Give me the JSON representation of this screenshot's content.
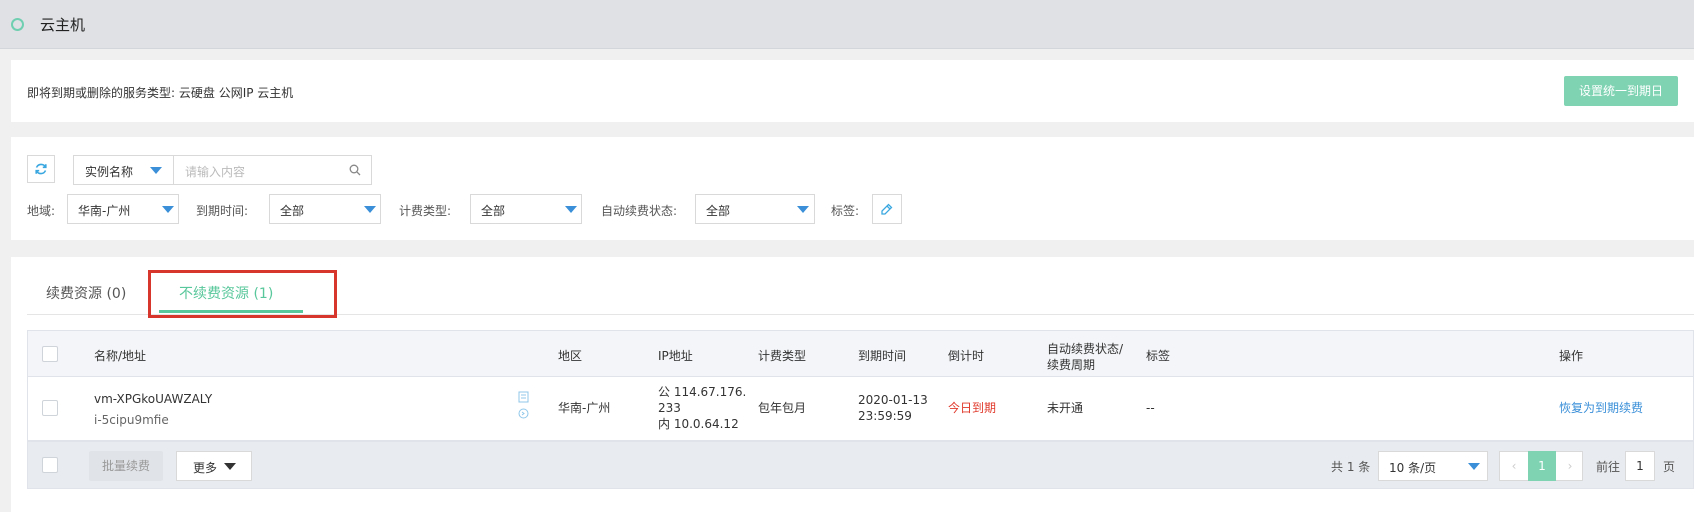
{
  "header": {
    "title": "云主机"
  },
  "notice": {
    "label": "即将到期或删除的服务类型:",
    "types": "云硬盘 公网IP 云主机",
    "set_button": "设置统一到期日"
  },
  "filters": {
    "search_field": "实例名称",
    "search_placeholder": "请输入内容",
    "region_label": "地域:",
    "region_value": "华南-广州",
    "expire_label": "到期时间:",
    "expire_value": "全部",
    "billing_label": "计费类型:",
    "billing_value": "全部",
    "autorenew_label": "自动续费状态:",
    "autorenew_value": "全部",
    "tag_label": "标签:"
  },
  "tabs": [
    {
      "label": "续费资源 (0)",
      "active": false
    },
    {
      "label": "不续费资源 (1)",
      "active": true
    }
  ],
  "table": {
    "headers": {
      "name": "名称/地址",
      "region": "地区",
      "ip": "IP地址",
      "billing": "计费类型",
      "expire": "到期时间",
      "countdown": "倒计时",
      "autorenew_line1": "自动续费状态/",
      "autorenew_line2": "续费周期",
      "tag": "标签",
      "action": "操作"
    },
    "rows": [
      {
        "name": "vm-XPGkoUAWZALY",
        "id": "i-5cipu9mfie",
        "region": "华南-广州",
        "ip_public_line1": "公 114.67.176.",
        "ip_public_line2": "233",
        "ip_private": "内 10.0.64.12",
        "billing": "包年包月",
        "expire_date": "2020-01-13",
        "expire_time": "23:59:59",
        "countdown": "今日到期",
        "autorenew": "未开通",
        "tag": "--",
        "action": "恢复为到期续费"
      }
    ]
  },
  "footer": {
    "batch_button": "批量续费",
    "more_button": "更多",
    "total": "共 1 条",
    "page_size": "10 条/页",
    "current_page": "1",
    "goto_label": "前往",
    "goto_value": "1",
    "page_unit": "页"
  },
  "colors": {
    "accent": "#58c79b",
    "button_green": "#7fd3b3",
    "link_blue": "#3a8fd8",
    "danger": "#e0392b",
    "highlight_box": "#d6362c"
  },
  "icons": [
    "status-dot-icon",
    "refresh-icon",
    "search-icon",
    "chevron-down-icon",
    "tag-edit-icon",
    "copy-icon",
    "console-icon",
    "chevron-left-icon",
    "chevron-right-icon"
  ]
}
